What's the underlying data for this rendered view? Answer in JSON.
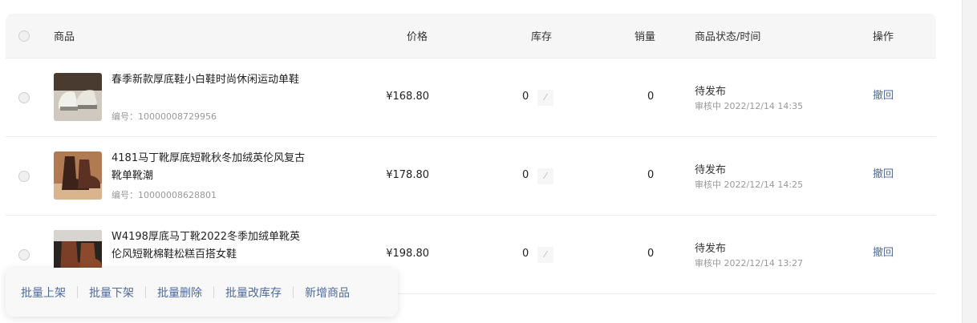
{
  "header": {
    "col_product": "商品",
    "col_price": "价格",
    "col_stock": "库存",
    "col_sales": "销量",
    "col_status": "商品状态/时间",
    "col_action": "操作"
  },
  "rows": [
    {
      "name": "春季新款厚底鞋小白鞋时尚休闲运动单鞋",
      "code": "编号：10000008729956",
      "price": "¥168.80",
      "stock": "0",
      "stock_edit_icon": "edit-icon",
      "sales": "0",
      "status": "待发布",
      "status_time": "审核中 2022/12/14 14:35",
      "action": "撤回"
    },
    {
      "name": "4181马丁靴厚底短靴秋冬加绒英伦风复古靴单靴潮",
      "code": "编号：10000008628801",
      "price": "¥178.80",
      "stock": "0",
      "stock_edit_icon": "edit-icon",
      "sales": "0",
      "status": "待发布",
      "status_time": "审核中 2022/12/14 14:25",
      "action": "撤回"
    },
    {
      "name": "W4198厚底马丁靴2022冬季加绒单靴英伦风短靴棉鞋松糕百搭女鞋",
      "code": "",
      "price": "¥198.80",
      "stock": "0",
      "stock_edit_icon": "edit-icon",
      "sales": "0",
      "status": "待发布",
      "status_time": "审核中 2022/12/14 13:27",
      "action": "撤回"
    }
  ],
  "bulk_actions": [
    "批量上架",
    "批量下架",
    "批量删除",
    "批量改库存",
    "新增商品"
  ],
  "colors": {
    "link": "#4e6a9b",
    "header_bg": "#f6f6f6",
    "muted_text": "#999999"
  }
}
